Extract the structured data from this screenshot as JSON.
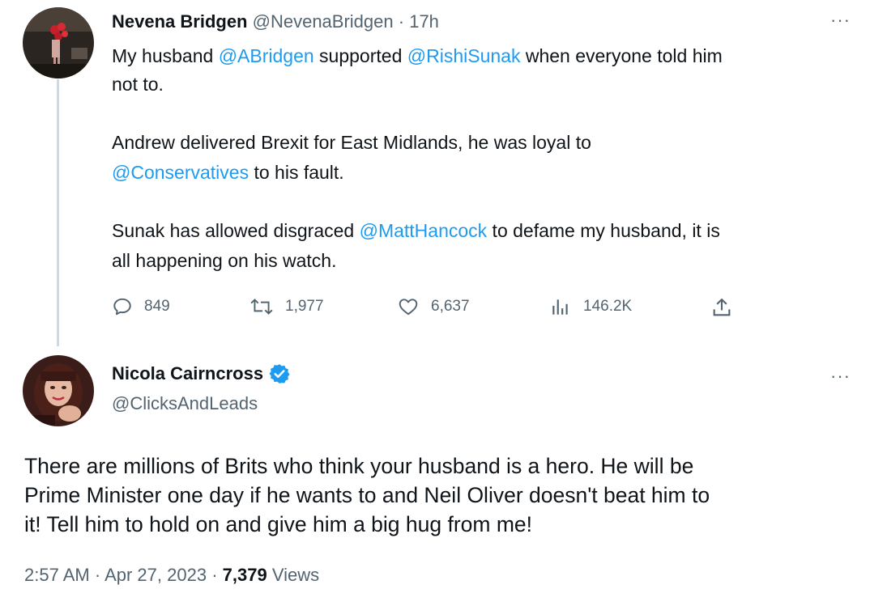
{
  "tweet": {
    "author_name": "Nevena Bridgen",
    "handle": "@NevenaBridgen",
    "separator": "·",
    "time": "17h",
    "more": "···",
    "lines": [
      {
        "pre": "My husband ",
        "m1": "@ABridgen",
        "mid": " supported ",
        "m2": "@RishiSunak",
        "post": " when everyone told him"
      },
      {
        "pre": "not to."
      },
      {
        "pre": "Andrew delivered Brexit for East Midlands, he was loyal to"
      },
      {
        "m1": "@Conservatives",
        "post": " to his fault."
      },
      {
        "pre": "Sunak has allowed disgraced ",
        "m1": "@MattHancock",
        "post": " to defame my husband, it is"
      },
      {
        "pre": "all happening on his watch."
      }
    ],
    "stats": {
      "replies": "849",
      "retweets": "1,977",
      "likes": "6,637",
      "views": "146.2K"
    }
  },
  "reply": {
    "author_name": "Nicola Cairncross",
    "handle": "@ClicksAndLeads",
    "more": "···",
    "lines": [
      "There are millions of Brits who think your husband is a hero. He will be",
      "Prime Minister one day if he wants to and Neil Oliver doesn't beat him to",
      "it!  Tell him to hold on and give him a big hug from me!"
    ],
    "footer": {
      "time": "2:57 AM",
      "dot1": "·",
      "date": "Apr 27, 2023",
      "dot2": "·",
      "views_count": "7,379",
      "views_label": "Views"
    }
  },
  "colors": {
    "mention": "#1d9bf0",
    "muted": "#536471",
    "verified": "#1d9bf0"
  },
  "icons": [
    "reply-icon",
    "retweet-icon",
    "like-icon",
    "views-icon",
    "share-icon",
    "verified-badge-icon",
    "more-icon"
  ]
}
